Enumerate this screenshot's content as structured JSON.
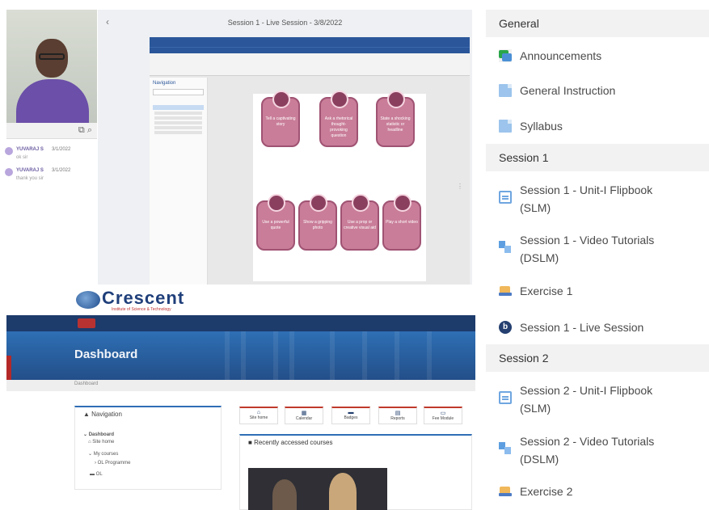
{
  "conference": {
    "session_title": "Session 1 - Live Session - 3/8/2022",
    "back_icon": "chevron-left-icon",
    "chat": [
      {
        "name": "YUVARAJ S",
        "date": "3/1/2022",
        "time": "10:01 A",
        "message": "ok sir"
      },
      {
        "name": "YUVARAJ S",
        "date": "3/1/2022",
        "time": "10:02 A",
        "message": "thank you sir"
      }
    ]
  },
  "shared_doc": {
    "app": "Word",
    "nav_pane_title": "Navigation",
    "cards_top": [
      "Tell a captivating story",
      "Ask a rhetorical thought-provoking question",
      "State a shocking statistic or headline"
    ],
    "cards_bottom": [
      "Use a powerful quote",
      "Show a gripping photo",
      "Use a prop or creative visual aid",
      "Play a short video"
    ]
  },
  "lms": {
    "brand": "Crescent",
    "brand_sub": "Institute of Science & Technology",
    "page_title": "Dashboard",
    "breadcrumb": "Dashboard",
    "navigation": {
      "title": "Navigation",
      "items": [
        "Dashboard",
        "Site home",
        "My courses",
        "OL Programme",
        "OL"
      ]
    },
    "shortcuts": [
      "Site home",
      "Calendar",
      "Badges",
      "Reports",
      "Fee Module"
    ],
    "recent": {
      "title": "Recently accessed courses"
    }
  },
  "course_index": {
    "sections": [
      {
        "title": "General",
        "activities": [
          {
            "icon": "announcements-icon",
            "label": "Announcements"
          },
          {
            "icon": "file-icon",
            "label": "General Instruction"
          },
          {
            "icon": "file-icon",
            "label": "Syllabus"
          }
        ]
      },
      {
        "title": "Session 1",
        "activities": [
          {
            "icon": "flipbook-icon",
            "label": "Session 1 - Unit-I Flipbook (SLM)"
          },
          {
            "icon": "video-icon",
            "label": "Session 1 - Video Tutorials (DSLM)"
          },
          {
            "icon": "quiz-icon",
            "label": "Exercise 1"
          },
          {
            "icon": "bigbluebutton-icon",
            "label": "Session 1 - Live Session"
          }
        ]
      },
      {
        "title": "Session 2",
        "activities": [
          {
            "icon": "flipbook-icon",
            "label": "Session 2 - Unit-I Flipbook (SLM)"
          },
          {
            "icon": "video-icon",
            "label": "Session 2 - Video Tutorials (DSLM)"
          },
          {
            "icon": "quiz-icon",
            "label": "Exercise 2"
          }
        ]
      }
    ]
  }
}
